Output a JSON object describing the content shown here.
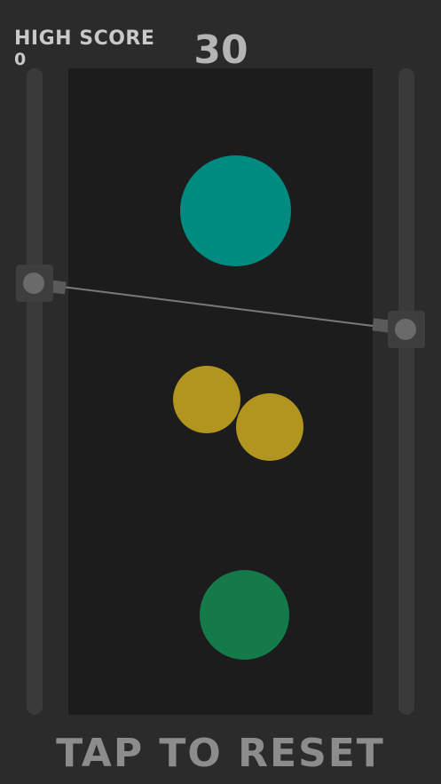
{
  "hud": {
    "high_score_label": "HIGH SCORE",
    "high_score_value": "0",
    "score": "30"
  },
  "footer": {
    "reset_label": "TAP TO RESET"
  },
  "colors": {
    "background": "#2b2b2b",
    "field": "#1c1c1c",
    "track": "#3a3a3a",
    "teal_ball": "#008b80",
    "yellow_ball": "#b1951f",
    "green_ball": "#147a4a",
    "line": "#7a7a7a"
  },
  "balls": [
    {
      "name": "teal-ball",
      "color": "teal"
    },
    {
      "name": "yellow-ball-left",
      "color": "yellow"
    },
    {
      "name": "yellow-ball-right",
      "color": "yellow"
    },
    {
      "name": "green-ball",
      "color": "green"
    }
  ]
}
